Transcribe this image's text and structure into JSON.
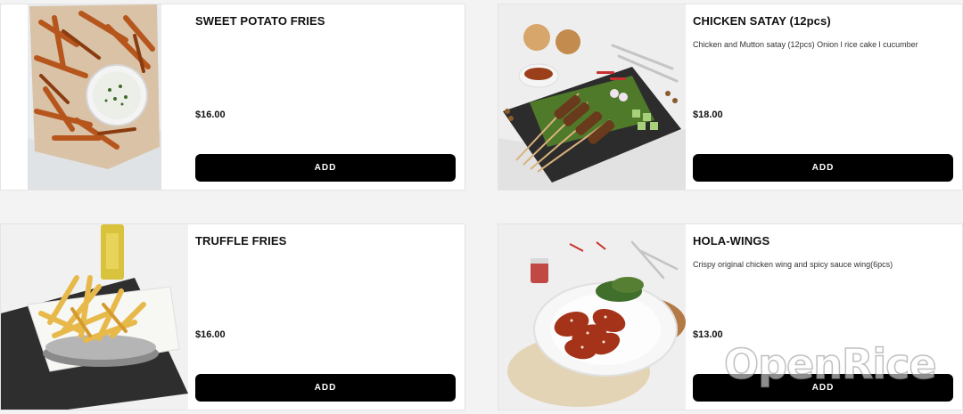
{
  "items": [
    {
      "name": "SWEET POTATO FRIES",
      "description": "",
      "price": "$16.00",
      "add_label": "ADD",
      "image": "sweet-potato-fries-photo"
    },
    {
      "name": "CHICKEN SATAY (12pcs)",
      "description": "Chicken and Mutton satay (12pcs) Onion l rice cake l cucumber",
      "price": "$18.00",
      "add_label": "ADD",
      "image": "chicken-satay-photo"
    },
    {
      "name": "TRUFFLE FRIES",
      "description": "",
      "price": "$16.00",
      "add_label": "ADD",
      "image": "truffle-fries-photo"
    },
    {
      "name": "HOLA-WINGS",
      "description": "Crispy original chicken wing and spicy sauce wing(6pcs)",
      "price": "$13.00",
      "add_label": "ADD",
      "image": "hola-wings-photo"
    }
  ],
  "watermark": "OpenRice",
  "colors": {
    "button_bg": "#000000",
    "button_text": "#ffffff",
    "card_bg": "#ffffff",
    "page_bg": "#f3f3f3"
  }
}
